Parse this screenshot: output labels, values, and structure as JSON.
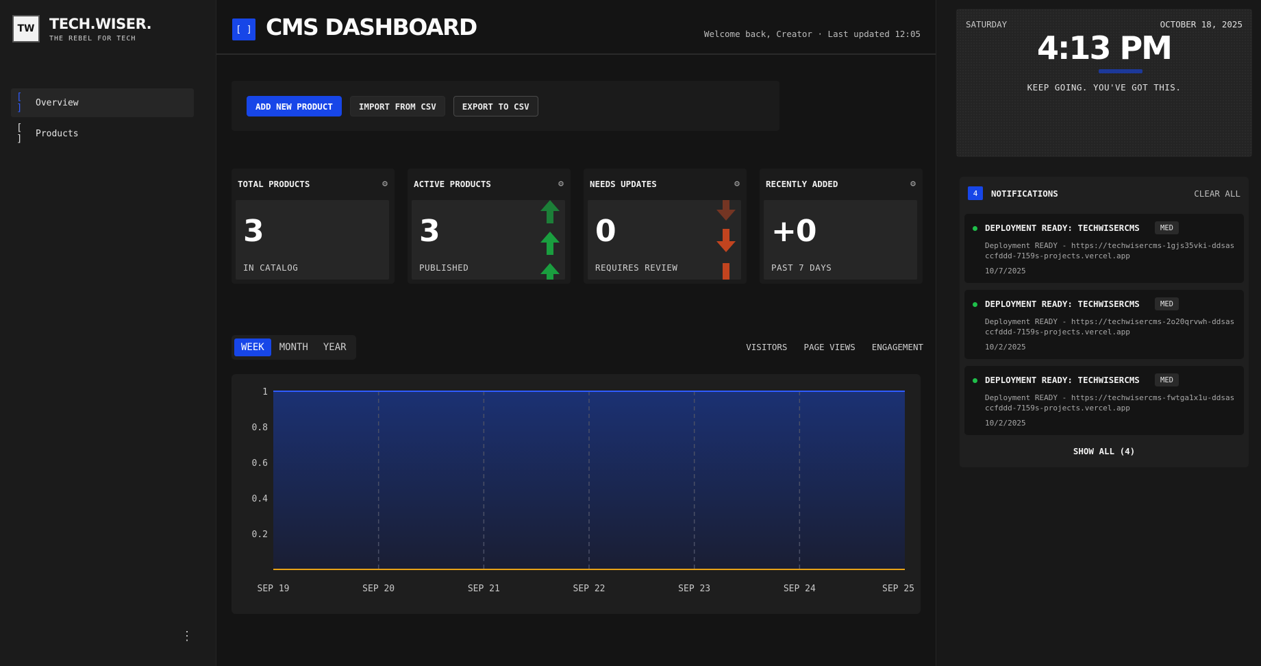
{
  "brand": {
    "logo": "TW",
    "name": "TECH.WISER.",
    "tagline": "THE REBEL FOR TECH"
  },
  "sidebar": {
    "items": [
      {
        "bracket": "[ ]",
        "label": "Overview",
        "active": true
      },
      {
        "bracket": "[ ]",
        "label": "Products",
        "active": false
      }
    ],
    "more": "⋮"
  },
  "header": {
    "icon": "[ ]",
    "title": "CMS DASHBOARD",
    "meta": "Welcome back, Creator · Last updated 12:05"
  },
  "toolbar": {
    "add_label": "ADD NEW PRODUCT",
    "import_label": "IMPORT FROM CSV",
    "export_label": "EXPORT TO CSV"
  },
  "cards": [
    {
      "title": "TOTAL PRODUCTS",
      "value": "3",
      "sub": "IN CATALOG",
      "trend": "none"
    },
    {
      "title": "ACTIVE PRODUCTS",
      "value": "3",
      "sub": "PUBLISHED",
      "trend": "up"
    },
    {
      "title": "NEEDS UPDATES",
      "value": "0",
      "sub": "REQUIRES REVIEW",
      "trend": "down"
    },
    {
      "title": "RECENTLY ADDED",
      "value": "+0",
      "sub": "PAST 7 DAYS",
      "trend": "none"
    }
  ],
  "colors": {
    "accent": "#1746e8",
    "up": "#1a9e3f",
    "down": "#c2441f",
    "line_primary": "#2f5cff",
    "line_secondary": "#e8a317"
  },
  "icons": {
    "gear": "⚙"
  },
  "chart_controls": {
    "ranges": [
      {
        "label": "WEEK",
        "active": true
      },
      {
        "label": "MONTH",
        "active": false
      },
      {
        "label": "YEAR",
        "active": false
      }
    ],
    "legend": [
      "VISITORS",
      "PAGE VIEWS",
      "ENGAGEMENT"
    ]
  },
  "chart_data": {
    "type": "area",
    "categories": [
      "SEP 19",
      "SEP 20",
      "SEP 21",
      "SEP 22",
      "SEP 23",
      "SEP 24",
      "SEP 25"
    ],
    "series": [
      {
        "values": [
          1,
          1,
          1,
          1,
          1,
          1,
          1
        ],
        "color": "#2f5cff"
      },
      {
        "values": [
          0,
          0,
          0,
          0,
          0,
          0,
          0
        ],
        "color": "#e8a317"
      }
    ],
    "yticks": [
      "1",
      "0.8",
      "0.6",
      "0.4",
      "0.2"
    ],
    "ylim": [
      0,
      1
    ],
    "grid": "vertical-dashed"
  },
  "clock": {
    "day": "SATURDAY",
    "date": "OCTOBER 18, 2025",
    "time": "4:13 PM",
    "message": "KEEP GOING. YOU'VE GOT THIS."
  },
  "notifications": {
    "count": "4",
    "title": "NOTIFICATIONS",
    "clear_label": "CLEAR ALL",
    "items": [
      {
        "title": "DEPLOYMENT READY: TECHWISERCMS",
        "priority": "MED",
        "desc": "Deployment READY - https://techwisercms-1gjs35vki-ddsasccfddd-7159s-projects.vercel.app",
        "date": "10/7/2025"
      },
      {
        "title": "DEPLOYMENT READY: TECHWISERCMS",
        "priority": "MED",
        "desc": "Deployment READY - https://techwisercms-2o20qrvwh-ddsasccfddd-7159s-projects.vercel.app",
        "date": "10/2/2025"
      },
      {
        "title": "DEPLOYMENT READY: TECHWISERCMS",
        "priority": "MED",
        "desc": "Deployment READY - https://techwisercms-fwtga1x1u-ddsasccfddd-7159s-projects.vercel.app",
        "date": "10/2/2025"
      }
    ],
    "show_all": "SHOW ALL (4)"
  }
}
